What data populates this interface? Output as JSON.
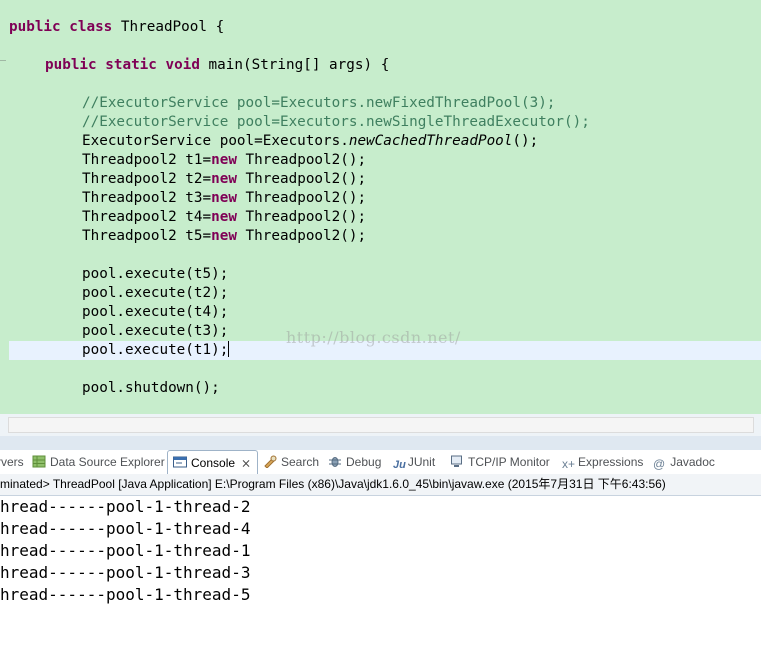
{
  "editor": {
    "lines": {
      "class_decl": {
        "kw": "public class ",
        "rest": "ThreadPool {"
      },
      "main_decl": {
        "kw": "public static void ",
        "rest": "main(String[] args) {"
      },
      "comment1": "//ExecutorService pool=Executors.newFixedThreadPool(3);",
      "comment2": "//ExecutorService pool=Executors.newSingleThreadExecutor();",
      "pool_decl": {
        "pre": "ExecutorService pool=Executors.",
        "method": "newCachedThreadPool",
        "post": "();"
      },
      "t_decls": [
        {
          "pre": "Threadpool2 t1=",
          "kw": "new",
          "post": " Threadpool2();"
        },
        {
          "pre": "Threadpool2 t2=",
          "kw": "new",
          "post": " Threadpool2();"
        },
        {
          "pre": "Threadpool2 t3=",
          "kw": "new",
          "post": " Threadpool2();"
        },
        {
          "pre": "Threadpool2 t4=",
          "kw": "new",
          "post": " Threadpool2();"
        },
        {
          "pre": "Threadpool2 t5=",
          "kw": "new",
          "post": " Threadpool2();"
        }
      ],
      "executes": [
        "pool.execute(t5);",
        "pool.execute(t2);",
        "pool.execute(t4);",
        "pool.execute(t3);",
        "pool.execute(t1);"
      ],
      "shutdown": "pool.shutdown();"
    },
    "watermark": "http://blog.csdn.net/"
  },
  "views": {
    "tabs": [
      {
        "label": "rvers",
        "icon": "servers-icon"
      },
      {
        "label": "Data Source Explorer",
        "icon": "data-source-icon"
      },
      {
        "label": "Console",
        "icon": "console-icon",
        "active": true
      },
      {
        "label": "Search",
        "icon": "search-icon"
      },
      {
        "label": "Debug",
        "icon": "debug-icon"
      },
      {
        "label": "JUnit",
        "icon": "junit-icon"
      },
      {
        "label": "TCP/IP Monitor",
        "icon": "tcpip-monitor-icon"
      },
      {
        "label": "Expressions",
        "icon": "expressions-icon"
      },
      {
        "label": "Javadoc",
        "icon": "javadoc-icon"
      }
    ]
  },
  "console": {
    "header": "minated> ThreadPool [Java Application] E:\\Program Files (x86)\\Java\\jdk1.6.0_45\\bin\\javaw.exe (2015年7月31日 下午6:43:56)",
    "output": [
      "hread------pool-1-thread-2",
      "hread------pool-1-thread-4",
      "hread------pool-1-thread-1",
      "hread------pool-1-thread-3",
      "hread------pool-1-thread-5"
    ]
  },
  "colors": {
    "editor_bg": "#c7edcc",
    "keyword": "#7f0055",
    "comment": "#3f7f5f",
    "current_line": "#e8f2fe"
  }
}
